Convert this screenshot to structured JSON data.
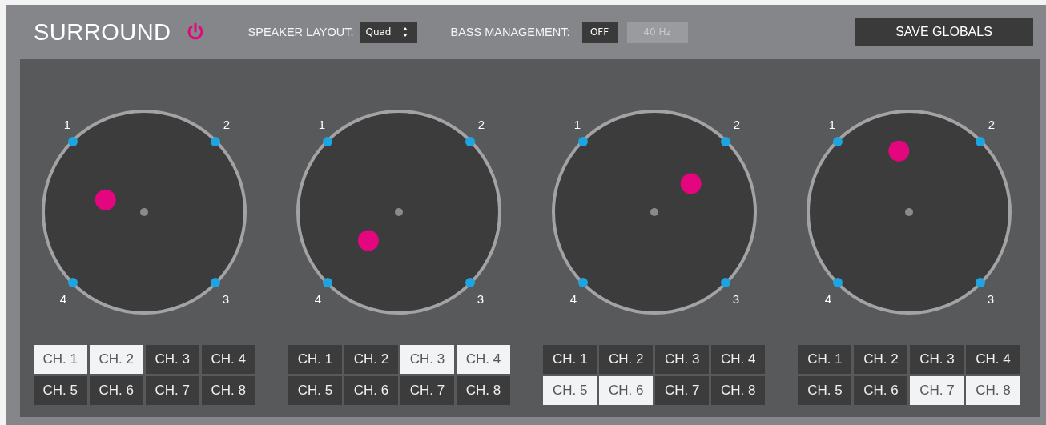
{
  "header": {
    "title": "SURROUND",
    "power_on": true,
    "speaker_layout": {
      "label": "SPEAKER LAYOUT:",
      "value": "Quad"
    },
    "bass_management": {
      "label": "BASS MANAGEMENT:",
      "toggle": "OFF",
      "on": false,
      "frequency": "40 Hz"
    },
    "save_button": "SAVE GLOBALS"
  },
  "panners": [
    {
      "speakers": [
        "1",
        "2",
        "4",
        "3"
      ],
      "channels": [
        {
          "label": "CH. 1",
          "selected": true
        },
        {
          "label": "CH. 2",
          "selected": true
        },
        {
          "label": "CH. 3",
          "selected": false
        },
        {
          "label": "CH. 4",
          "selected": false
        },
        {
          "label": "CH. 5",
          "selected": false
        },
        {
          "label": "CH. 6",
          "selected": false
        },
        {
          "label": "CH. 7",
          "selected": false
        },
        {
          "label": "CH. 8",
          "selected": false
        }
      ]
    },
    {
      "speakers": [
        "1",
        "2",
        "4",
        "3"
      ],
      "channels": [
        {
          "label": "CH. 1",
          "selected": false
        },
        {
          "label": "CH. 2",
          "selected": false
        },
        {
          "label": "CH. 3",
          "selected": true
        },
        {
          "label": "CH. 4",
          "selected": true
        },
        {
          "label": "CH. 5",
          "selected": false
        },
        {
          "label": "CH. 6",
          "selected": false
        },
        {
          "label": "CH. 7",
          "selected": false
        },
        {
          "label": "CH. 8",
          "selected": false
        }
      ]
    },
    {
      "speakers": [
        "1",
        "2",
        "4",
        "3"
      ],
      "channels": [
        {
          "label": "CH. 1",
          "selected": false
        },
        {
          "label": "CH. 2",
          "selected": false
        },
        {
          "label": "CH. 3",
          "selected": false
        },
        {
          "label": "CH. 4",
          "selected": false
        },
        {
          "label": "CH. 5",
          "selected": true
        },
        {
          "label": "CH. 6",
          "selected": true
        },
        {
          "label": "CH. 7",
          "selected": false
        },
        {
          "label": "CH. 8",
          "selected": false
        }
      ]
    },
    {
      "speakers": [
        "1",
        "2",
        "4",
        "3"
      ],
      "channels": [
        {
          "label": "CH. 1",
          "selected": false
        },
        {
          "label": "CH. 2",
          "selected": false
        },
        {
          "label": "CH. 3",
          "selected": false
        },
        {
          "label": "CH. 4",
          "selected": false
        },
        {
          "label": "CH. 5",
          "selected": false
        },
        {
          "label": "CH. 6",
          "selected": false
        },
        {
          "label": "CH. 7",
          "selected": true
        },
        {
          "label": "CH. 8",
          "selected": true
        }
      ]
    }
  ]
}
